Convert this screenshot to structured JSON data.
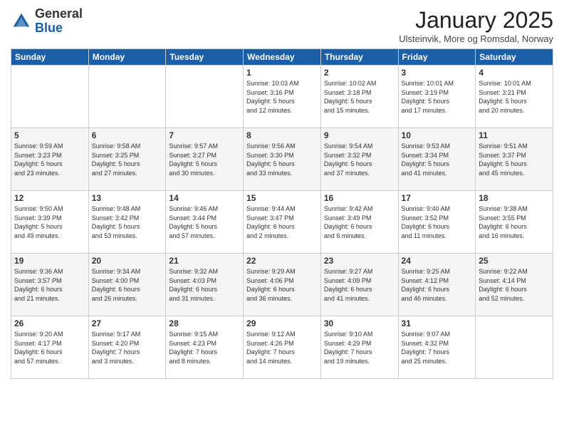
{
  "header": {
    "logo_line1": "General",
    "logo_line2": "Blue",
    "month": "January 2025",
    "location": "Ulsteinvik, More og Romsdal, Norway"
  },
  "weekdays": [
    "Sunday",
    "Monday",
    "Tuesday",
    "Wednesday",
    "Thursday",
    "Friday",
    "Saturday"
  ],
  "weeks": [
    [
      {
        "day": "",
        "info": ""
      },
      {
        "day": "",
        "info": ""
      },
      {
        "day": "",
        "info": ""
      },
      {
        "day": "1",
        "info": "Sunrise: 10:03 AM\nSunset: 3:16 PM\nDaylight: 5 hours\nand 12 minutes."
      },
      {
        "day": "2",
        "info": "Sunrise: 10:02 AM\nSunset: 3:18 PM\nDaylight: 5 hours\nand 15 minutes."
      },
      {
        "day": "3",
        "info": "Sunrise: 10:01 AM\nSunset: 3:19 PM\nDaylight: 5 hours\nand 17 minutes."
      },
      {
        "day": "4",
        "info": "Sunrise: 10:01 AM\nSunset: 3:21 PM\nDaylight: 5 hours\nand 20 minutes."
      }
    ],
    [
      {
        "day": "5",
        "info": "Sunrise: 9:59 AM\nSunset: 3:23 PM\nDaylight: 5 hours\nand 23 minutes."
      },
      {
        "day": "6",
        "info": "Sunrise: 9:58 AM\nSunset: 3:25 PM\nDaylight: 5 hours\nand 27 minutes."
      },
      {
        "day": "7",
        "info": "Sunrise: 9:57 AM\nSunset: 3:27 PM\nDaylight: 5 hours\nand 30 minutes."
      },
      {
        "day": "8",
        "info": "Sunrise: 9:56 AM\nSunset: 3:30 PM\nDaylight: 5 hours\nand 33 minutes."
      },
      {
        "day": "9",
        "info": "Sunrise: 9:54 AM\nSunset: 3:32 PM\nDaylight: 5 hours\nand 37 minutes."
      },
      {
        "day": "10",
        "info": "Sunrise: 9:53 AM\nSunset: 3:34 PM\nDaylight: 5 hours\nand 41 minutes."
      },
      {
        "day": "11",
        "info": "Sunrise: 9:51 AM\nSunset: 3:37 PM\nDaylight: 5 hours\nand 45 minutes."
      }
    ],
    [
      {
        "day": "12",
        "info": "Sunrise: 9:50 AM\nSunset: 3:39 PM\nDaylight: 5 hours\nand 49 minutes."
      },
      {
        "day": "13",
        "info": "Sunrise: 9:48 AM\nSunset: 3:42 PM\nDaylight: 5 hours\nand 53 minutes."
      },
      {
        "day": "14",
        "info": "Sunrise: 9:46 AM\nSunset: 3:44 PM\nDaylight: 5 hours\nand 57 minutes."
      },
      {
        "day": "15",
        "info": "Sunrise: 9:44 AM\nSunset: 3:47 PM\nDaylight: 6 hours\nand 2 minutes."
      },
      {
        "day": "16",
        "info": "Sunrise: 9:42 AM\nSunset: 3:49 PM\nDaylight: 6 hours\nand 6 minutes."
      },
      {
        "day": "17",
        "info": "Sunrise: 9:40 AM\nSunset: 3:52 PM\nDaylight: 6 hours\nand 11 minutes."
      },
      {
        "day": "18",
        "info": "Sunrise: 9:38 AM\nSunset: 3:55 PM\nDaylight: 6 hours\nand 16 minutes."
      }
    ],
    [
      {
        "day": "19",
        "info": "Sunrise: 9:36 AM\nSunset: 3:57 PM\nDaylight: 6 hours\nand 21 minutes."
      },
      {
        "day": "20",
        "info": "Sunrise: 9:34 AM\nSunset: 4:00 PM\nDaylight: 6 hours\nand 26 minutes."
      },
      {
        "day": "21",
        "info": "Sunrise: 9:32 AM\nSunset: 4:03 PM\nDaylight: 6 hours\nand 31 minutes."
      },
      {
        "day": "22",
        "info": "Sunrise: 9:29 AM\nSunset: 4:06 PM\nDaylight: 6 hours\nand 36 minutes."
      },
      {
        "day": "23",
        "info": "Sunrise: 9:27 AM\nSunset: 4:09 PM\nDaylight: 6 hours\nand 41 minutes."
      },
      {
        "day": "24",
        "info": "Sunrise: 9:25 AM\nSunset: 4:12 PM\nDaylight: 6 hours\nand 46 minutes."
      },
      {
        "day": "25",
        "info": "Sunrise: 9:22 AM\nSunset: 4:14 PM\nDaylight: 6 hours\nand 52 minutes."
      }
    ],
    [
      {
        "day": "26",
        "info": "Sunrise: 9:20 AM\nSunset: 4:17 PM\nDaylight: 6 hours\nand 57 minutes."
      },
      {
        "day": "27",
        "info": "Sunrise: 9:17 AM\nSunset: 4:20 PM\nDaylight: 7 hours\nand 3 minutes."
      },
      {
        "day": "28",
        "info": "Sunrise: 9:15 AM\nSunset: 4:23 PM\nDaylight: 7 hours\nand 8 minutes."
      },
      {
        "day": "29",
        "info": "Sunrise: 9:12 AM\nSunset: 4:26 PM\nDaylight: 7 hours\nand 14 minutes."
      },
      {
        "day": "30",
        "info": "Sunrise: 9:10 AM\nSunset: 4:29 PM\nDaylight: 7 hours\nand 19 minutes."
      },
      {
        "day": "31",
        "info": "Sunrise: 9:07 AM\nSunset: 4:32 PM\nDaylight: 7 hours\nand 25 minutes."
      },
      {
        "day": "",
        "info": ""
      }
    ]
  ]
}
